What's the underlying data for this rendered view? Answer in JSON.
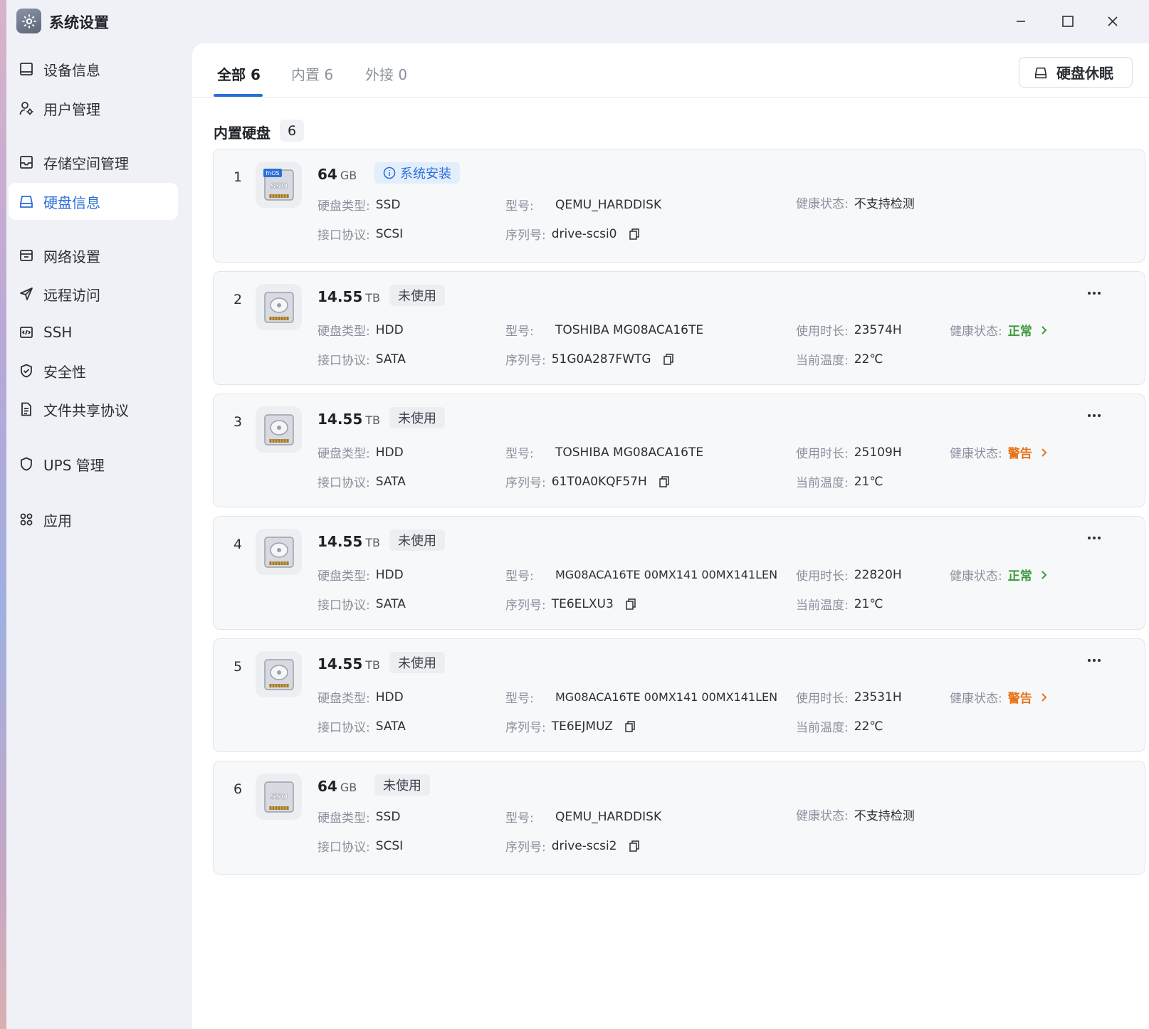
{
  "app": {
    "title": "系统设置"
  },
  "sidebar": {
    "items": [
      {
        "label": "设备信息",
        "icon": "monitor-icon"
      },
      {
        "label": "用户管理",
        "icon": "user-settings-icon"
      },
      {
        "label": "存储空间管理",
        "icon": "storage-icon"
      },
      {
        "label": "硬盘信息",
        "icon": "harddisk-icon",
        "active": true
      },
      {
        "label": "网络设置",
        "icon": "network-icon"
      },
      {
        "label": "远程访问",
        "icon": "send-icon"
      },
      {
        "label": "SSH",
        "icon": "code-icon"
      },
      {
        "label": "安全性",
        "icon": "shield-check-icon"
      },
      {
        "label": "文件共享协议",
        "icon": "document-icon"
      },
      {
        "label": "UPS 管理",
        "icon": "shield-icon"
      },
      {
        "label": "应用",
        "icon": "apps-icon"
      }
    ]
  },
  "tabs": [
    {
      "label": "全部 6",
      "active": true
    },
    {
      "label": "内置 6"
    },
    {
      "label": "外接 0"
    }
  ],
  "toolbar": {
    "sleep_label": "硬盘休眠"
  },
  "section": {
    "title": "内置硬盘",
    "count": "6"
  },
  "labels": {
    "disk_type": "硬盘类型:",
    "interface": "接口协议:",
    "model": "型号:",
    "serial": "序列号:",
    "hours": "使用时长:",
    "temp": "当前温度:",
    "health": "健康状态:"
  },
  "disks": [
    {
      "index": "1",
      "size": "64",
      "unit": "GB",
      "badge": "系统安装",
      "badge_kind": "system",
      "icon_label": "SSD",
      "icon_brand": "fnOS",
      "disk_type": "SSD",
      "interface": "SCSI",
      "model": "QEMU_HARDDISK",
      "serial": "drive-scsi0",
      "health": "不支持检测"
    },
    {
      "index": "2",
      "size": "14.55",
      "unit": "TB",
      "badge": "未使用",
      "badge_kind": "plain",
      "disk_type": "HDD",
      "interface": "SATA",
      "model": "TOSHIBA MG08ACA16TE",
      "serial": "51G0A287FWTG",
      "hours": "23574H",
      "temp": "22℃",
      "health": "正常",
      "health_level": "ok",
      "health_color": "#3a9a3a"
    },
    {
      "index": "3",
      "size": "14.55",
      "unit": "TB",
      "badge": "未使用",
      "badge_kind": "plain",
      "disk_type": "HDD",
      "interface": "SATA",
      "model": "TOSHIBA MG08ACA16TE",
      "serial": "61T0A0KQF57H",
      "hours": "25109H",
      "temp": "21℃",
      "health": "警告",
      "health_level": "warn",
      "health_color": "#e8741a"
    },
    {
      "index": "4",
      "size": "14.55",
      "unit": "TB",
      "badge": "未使用",
      "badge_kind": "plain",
      "disk_type": "HDD",
      "interface": "SATA",
      "model": "MG08ACA16TE 00MX141 00MX141LEN",
      "serial": "TE6ELXU3",
      "hours": "22820H",
      "temp": "21℃",
      "health": "正常",
      "health_level": "ok",
      "health_color": "#3a9a3a"
    },
    {
      "index": "5",
      "size": "14.55",
      "unit": "TB",
      "badge": "未使用",
      "badge_kind": "plain",
      "disk_type": "HDD",
      "interface": "SATA",
      "model": "MG08ACA16TE 00MX141 00MX141LEN",
      "serial": "TE6EJMUZ",
      "hours": "23531H",
      "temp": "22℃",
      "health": "警告",
      "health_level": "warn",
      "health_color": "#e8741a"
    },
    {
      "index": "6",
      "size": "64",
      "unit": "GB",
      "badge": "未使用",
      "badge_kind": "plain",
      "icon_label": "SSD",
      "disk_type": "SSD",
      "interface": "SCSI",
      "model": "QEMU_HARDDISK",
      "serial": "drive-scsi2",
      "health": "不支持检测"
    }
  ],
  "colors": {
    "accent": "#2a6fd8",
    "ok": "#3a9a3a",
    "warn": "#e8741a"
  }
}
